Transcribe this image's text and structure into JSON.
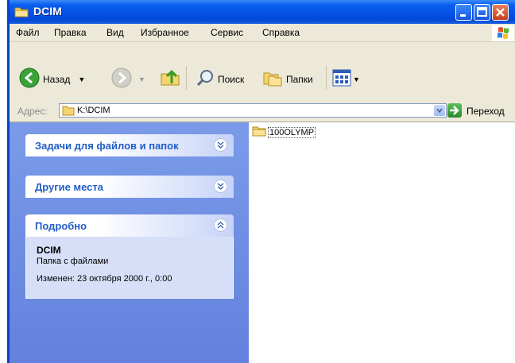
{
  "window": {
    "title": "DCIM"
  },
  "menu": [
    "Файл",
    "Правка",
    "Вид",
    "Избранное",
    "Сервис",
    "Справка"
  ],
  "toolbar": {
    "back": "Назад",
    "search": "Поиск",
    "folders": "Папки"
  },
  "address": {
    "label": "Адрес:",
    "path": "K:\\DCIM",
    "go": "Переход"
  },
  "tasks": {
    "file_tasks": "Задачи для файлов и папок",
    "other_places": "Другие места",
    "details": "Подробно",
    "detail_name": "DCIM",
    "detail_type": "Папка с файлами",
    "detail_modified": "Изменен: 23 октября 2000 г., 0:00"
  },
  "files": [
    {
      "name": "100OLYMP"
    }
  ],
  "colors": {
    "titlebar": "#0551e6",
    "taskpane": "#7b9be9",
    "panel_title": "#215dc6"
  }
}
